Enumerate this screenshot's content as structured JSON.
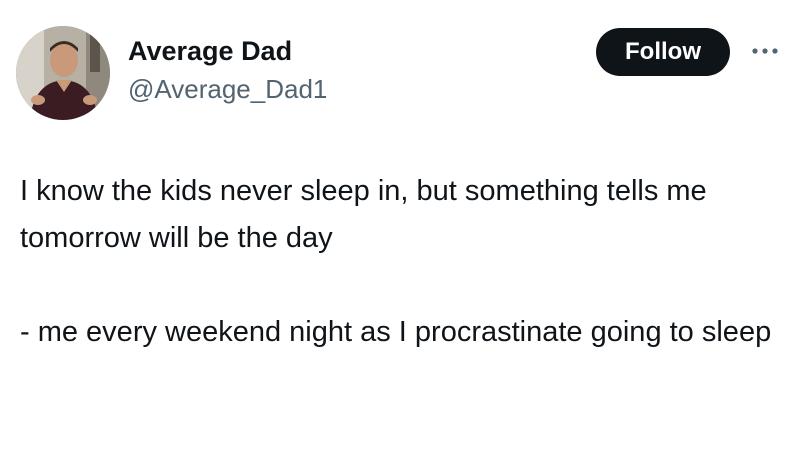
{
  "author": {
    "display_name": "Average Dad",
    "handle": "@Average_Dad1",
    "avatar_icon": "user-avatar-photo"
  },
  "actions": {
    "follow_label": "Follow",
    "more_icon": "more-options-icon"
  },
  "tweet": {
    "paragraphs": [
      "I know the kids never sleep in, but something tells me tomorrow will be the day",
      "- me every weekend night as I procrastinate going to sleep"
    ]
  },
  "colors": {
    "text": "#0f1419",
    "secondary_text": "#536471",
    "follow_bg": "#0f1419",
    "follow_text": "#ffffff",
    "background": "#ffffff"
  }
}
